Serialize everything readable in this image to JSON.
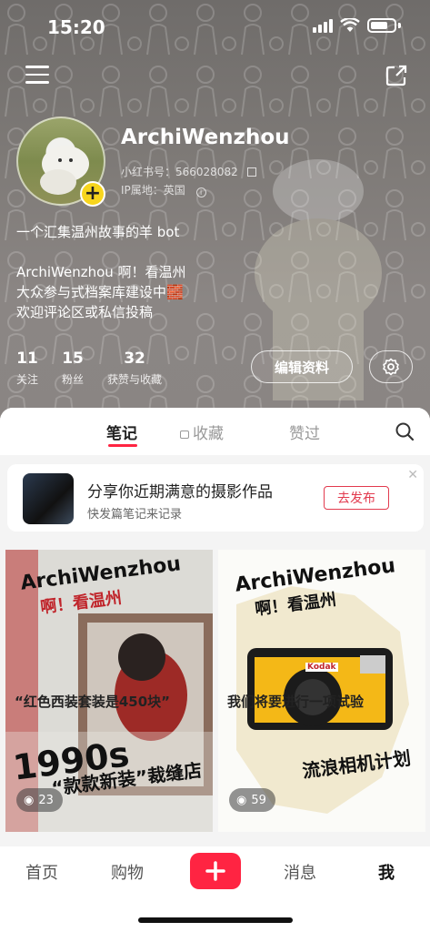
{
  "status_bar": {
    "time": "15:20"
  },
  "profile": {
    "username": "ArchiWenzhou",
    "red_id": "小红书号：566028082",
    "ip_location": "IP属地：英国",
    "bio_line1": "一个汇集温州故事的羊 bot",
    "bio_line2": "ArchiWenzhou 啊！看温州",
    "bio_line3": "大众参与式档案库建设中🧱",
    "bio_line4": "欢迎评论区或私信投稿"
  },
  "stats": [
    {
      "num": "11",
      "label": "关注"
    },
    {
      "num": "15",
      "label": "粉丝"
    },
    {
      "num": "32",
      "label": "获赞与收藏"
    }
  ],
  "actions": {
    "edit_profile": "编辑资料"
  },
  "tabs": {
    "notes": "笔记",
    "collections": "收藏",
    "likes": "赞过"
  },
  "promo": {
    "title": "分享你近期满意的摄影作品",
    "subtitle": "快发篇笔记来记录",
    "button": "去发布"
  },
  "posts": [
    {
      "brand": "ArchiWenzhou",
      "brand_sub": "啊！看温州",
      "headline_1": "1990s",
      "headline_2": "“款款新装”裁缝店",
      "views": "23",
      "caption": "“红色西装套装是450块”"
    },
    {
      "brand": "ArchiWenzhou",
      "brand_sub": "啊！看温州",
      "headline": "流浪相机计划",
      "camera_brand": "Kodak",
      "views": "59",
      "caption": "我们将要进行一项试验"
    }
  ],
  "bottom_nav": {
    "home": "首页",
    "shop": "购物",
    "messages": "消息",
    "me": "我"
  },
  "colors": {
    "accent": "#ff2442",
    "badge_yellow": "#f7d51d"
  }
}
